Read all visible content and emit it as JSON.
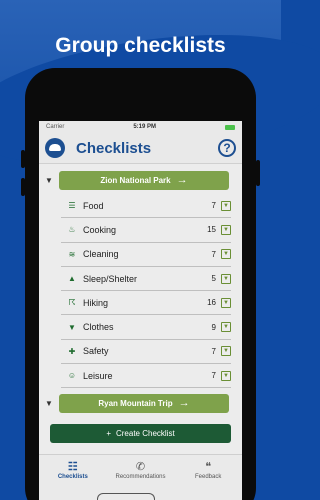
{
  "promo": {
    "title": "Group checklists"
  },
  "status": {
    "carrier": "Carrier",
    "time": "5:19 PM"
  },
  "header": {
    "title": "Checklists",
    "help": "?"
  },
  "groups": [
    {
      "label": "Zion National Park"
    },
    {
      "label": "Ryan Mountain Trip"
    }
  ],
  "items": [
    {
      "name": "Food",
      "count": "7",
      "icon": "burger-icon",
      "glyph": "☰"
    },
    {
      "name": "Cooking",
      "count": "15",
      "icon": "fire-icon",
      "glyph": "♨"
    },
    {
      "name": "Cleaning",
      "count": "7",
      "icon": "soap-icon",
      "glyph": "≋"
    },
    {
      "name": "Sleep/Shelter",
      "count": "5",
      "icon": "tent-icon",
      "glyph": "▲"
    },
    {
      "name": "Hiking",
      "count": "16",
      "icon": "hiker-icon",
      "glyph": "☈"
    },
    {
      "name": "Clothes",
      "count": "9",
      "icon": "shirt-icon",
      "glyph": "▼"
    },
    {
      "name": "Safety",
      "count": "7",
      "icon": "first-aid-icon",
      "glyph": "✚"
    },
    {
      "name": "Leisure",
      "count": "7",
      "icon": "smile-icon",
      "glyph": "☺"
    }
  ],
  "create_button": {
    "label": "Create Checklist"
  },
  "tabs": [
    {
      "label": "Checklists",
      "icon": "checklist-icon"
    },
    {
      "label": "Recommendations",
      "icon": "chat-icon"
    },
    {
      "label": "Feedback",
      "icon": "speech-bubbles-icon"
    }
  ]
}
